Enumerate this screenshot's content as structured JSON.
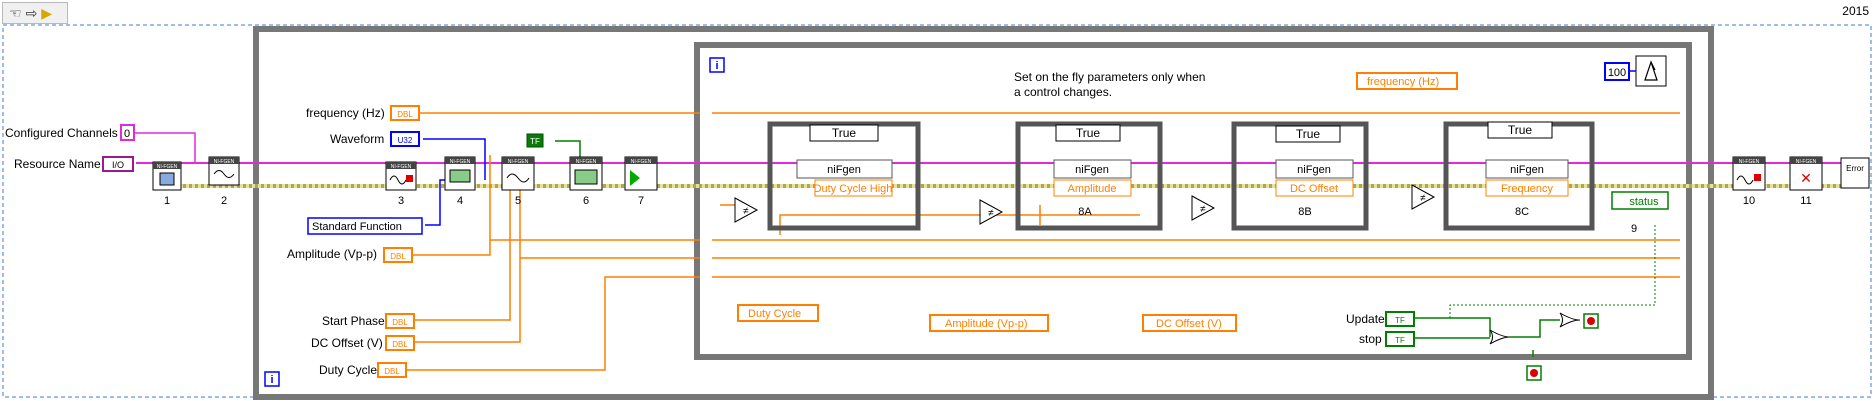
{
  "toolbar": {
    "hand_icon": "hand-icon",
    "arrow_icon": "arrow-icon",
    "run_icon": "run-icon"
  },
  "version": "2015",
  "frames": {
    "flat_sequence_info": "i",
    "case_info": "i",
    "wait_ms": "100"
  },
  "labels": {
    "configured_channels": "Configured Channels",
    "resource_name": "Resource Name",
    "frequency": "frequency (Hz)",
    "waveform": "Waveform",
    "standard_function": "Standard Function",
    "amplitude_vpp": "Amplitude (Vp-p)",
    "start_phase": "Start Phase",
    "dc_offset": "DC Offset (V)",
    "duty_cycle": "Duty Cycle",
    "update": "Update",
    "stop": "stop"
  },
  "constants": {
    "channels_value": "0",
    "io_type": "I/O",
    "dbl": "DBL",
    "u32": "U32",
    "tf": "TF"
  },
  "comment": {
    "line1": "Set on the fly parameters only when",
    "line2": "a control changes."
  },
  "node_numbers": [
    "1",
    "2",
    "3",
    "4",
    "5",
    "6",
    "7",
    "8A",
    "8B",
    "8C",
    "9",
    "10",
    "11"
  ],
  "node_header": "NI-FGEN",
  "case_selector": "True",
  "property_nodes": {
    "class": "niFgen",
    "duty": "Duty Cycle High",
    "amplitude": "Amplitude",
    "offset": "DC Offset",
    "frequency": "Frequency"
  },
  "locals": {
    "frequency": "frequency (Hz)",
    "duty": "Duty Cycle",
    "amplitude": "Amplitude (Vp-p)",
    "offset": "DC Offset (V)"
  },
  "status": "status",
  "error_out": "Error",
  "colors": {
    "orange": "#ff8000",
    "pink": "#e32ad9",
    "blue": "#0000ff",
    "green": "#008000",
    "error_yellow": "#a4a000",
    "frame_gray": "#777777"
  }
}
